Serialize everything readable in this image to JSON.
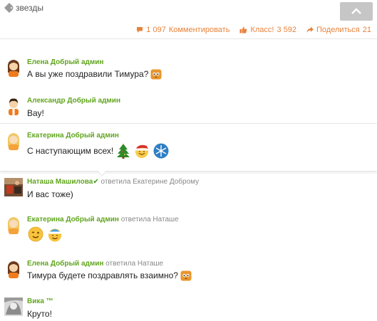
{
  "topbar": {
    "tag_label": "звезды"
  },
  "actions": {
    "comments_count": "1 097",
    "comments_label": "Комментировать",
    "likes_label": "Класс!",
    "likes_count": "3 592",
    "share_label": "Поделиться",
    "share_count": "21"
  },
  "comments": [
    {
      "author": "Елена Добрый админ",
      "reply_to": "",
      "text": "А вы уже поздравили Тимура?",
      "avatar": "avatar-girl-icon",
      "emojis": [
        "cat-face-emoji"
      ]
    },
    {
      "author": "Александр Добрый админ",
      "reply_to": "",
      "text": "Вау!",
      "avatar": "avatar-boy-icon",
      "emojis": []
    },
    {
      "author": "Екатерина Добрый админ",
      "reply_to": "",
      "text": "С наступающим всех!",
      "avatar": "avatar-blonde-girl-icon",
      "emojis": [
        "christmas-tree-emoji",
        "santa-smiley-emoji",
        "snowflake-emoji"
      ]
    },
    {
      "author": "Наташа Машилова",
      "reply_to": "ответила Екатерине Доброму",
      "text": "И вас тоже)",
      "avatar": "user-photo",
      "emojis": []
    },
    {
      "author": "Екатерина Добрый админ",
      "reply_to": "ответила Наташе",
      "text": "",
      "avatar": "avatar-blonde-girl-icon",
      "emojis": [
        "wink-smiley-emoji",
        "winter-hat-smiley-emoji"
      ]
    },
    {
      "author": "Елена Добрый админ",
      "reply_to": "ответила Наташе",
      "text": "Тимура будете поздравлять взаимно?",
      "avatar": "avatar-girl-icon",
      "emojis": [
        "cat-face-emoji"
      ]
    },
    {
      "author": "Вика ™",
      "reply_to": "",
      "text": "Круто!",
      "avatar": "user-photo",
      "emojis": []
    }
  ],
  "colors": {
    "accent": "#e9833b",
    "author": "#61a51f",
    "scroll_button": "#c6c6c6"
  }
}
